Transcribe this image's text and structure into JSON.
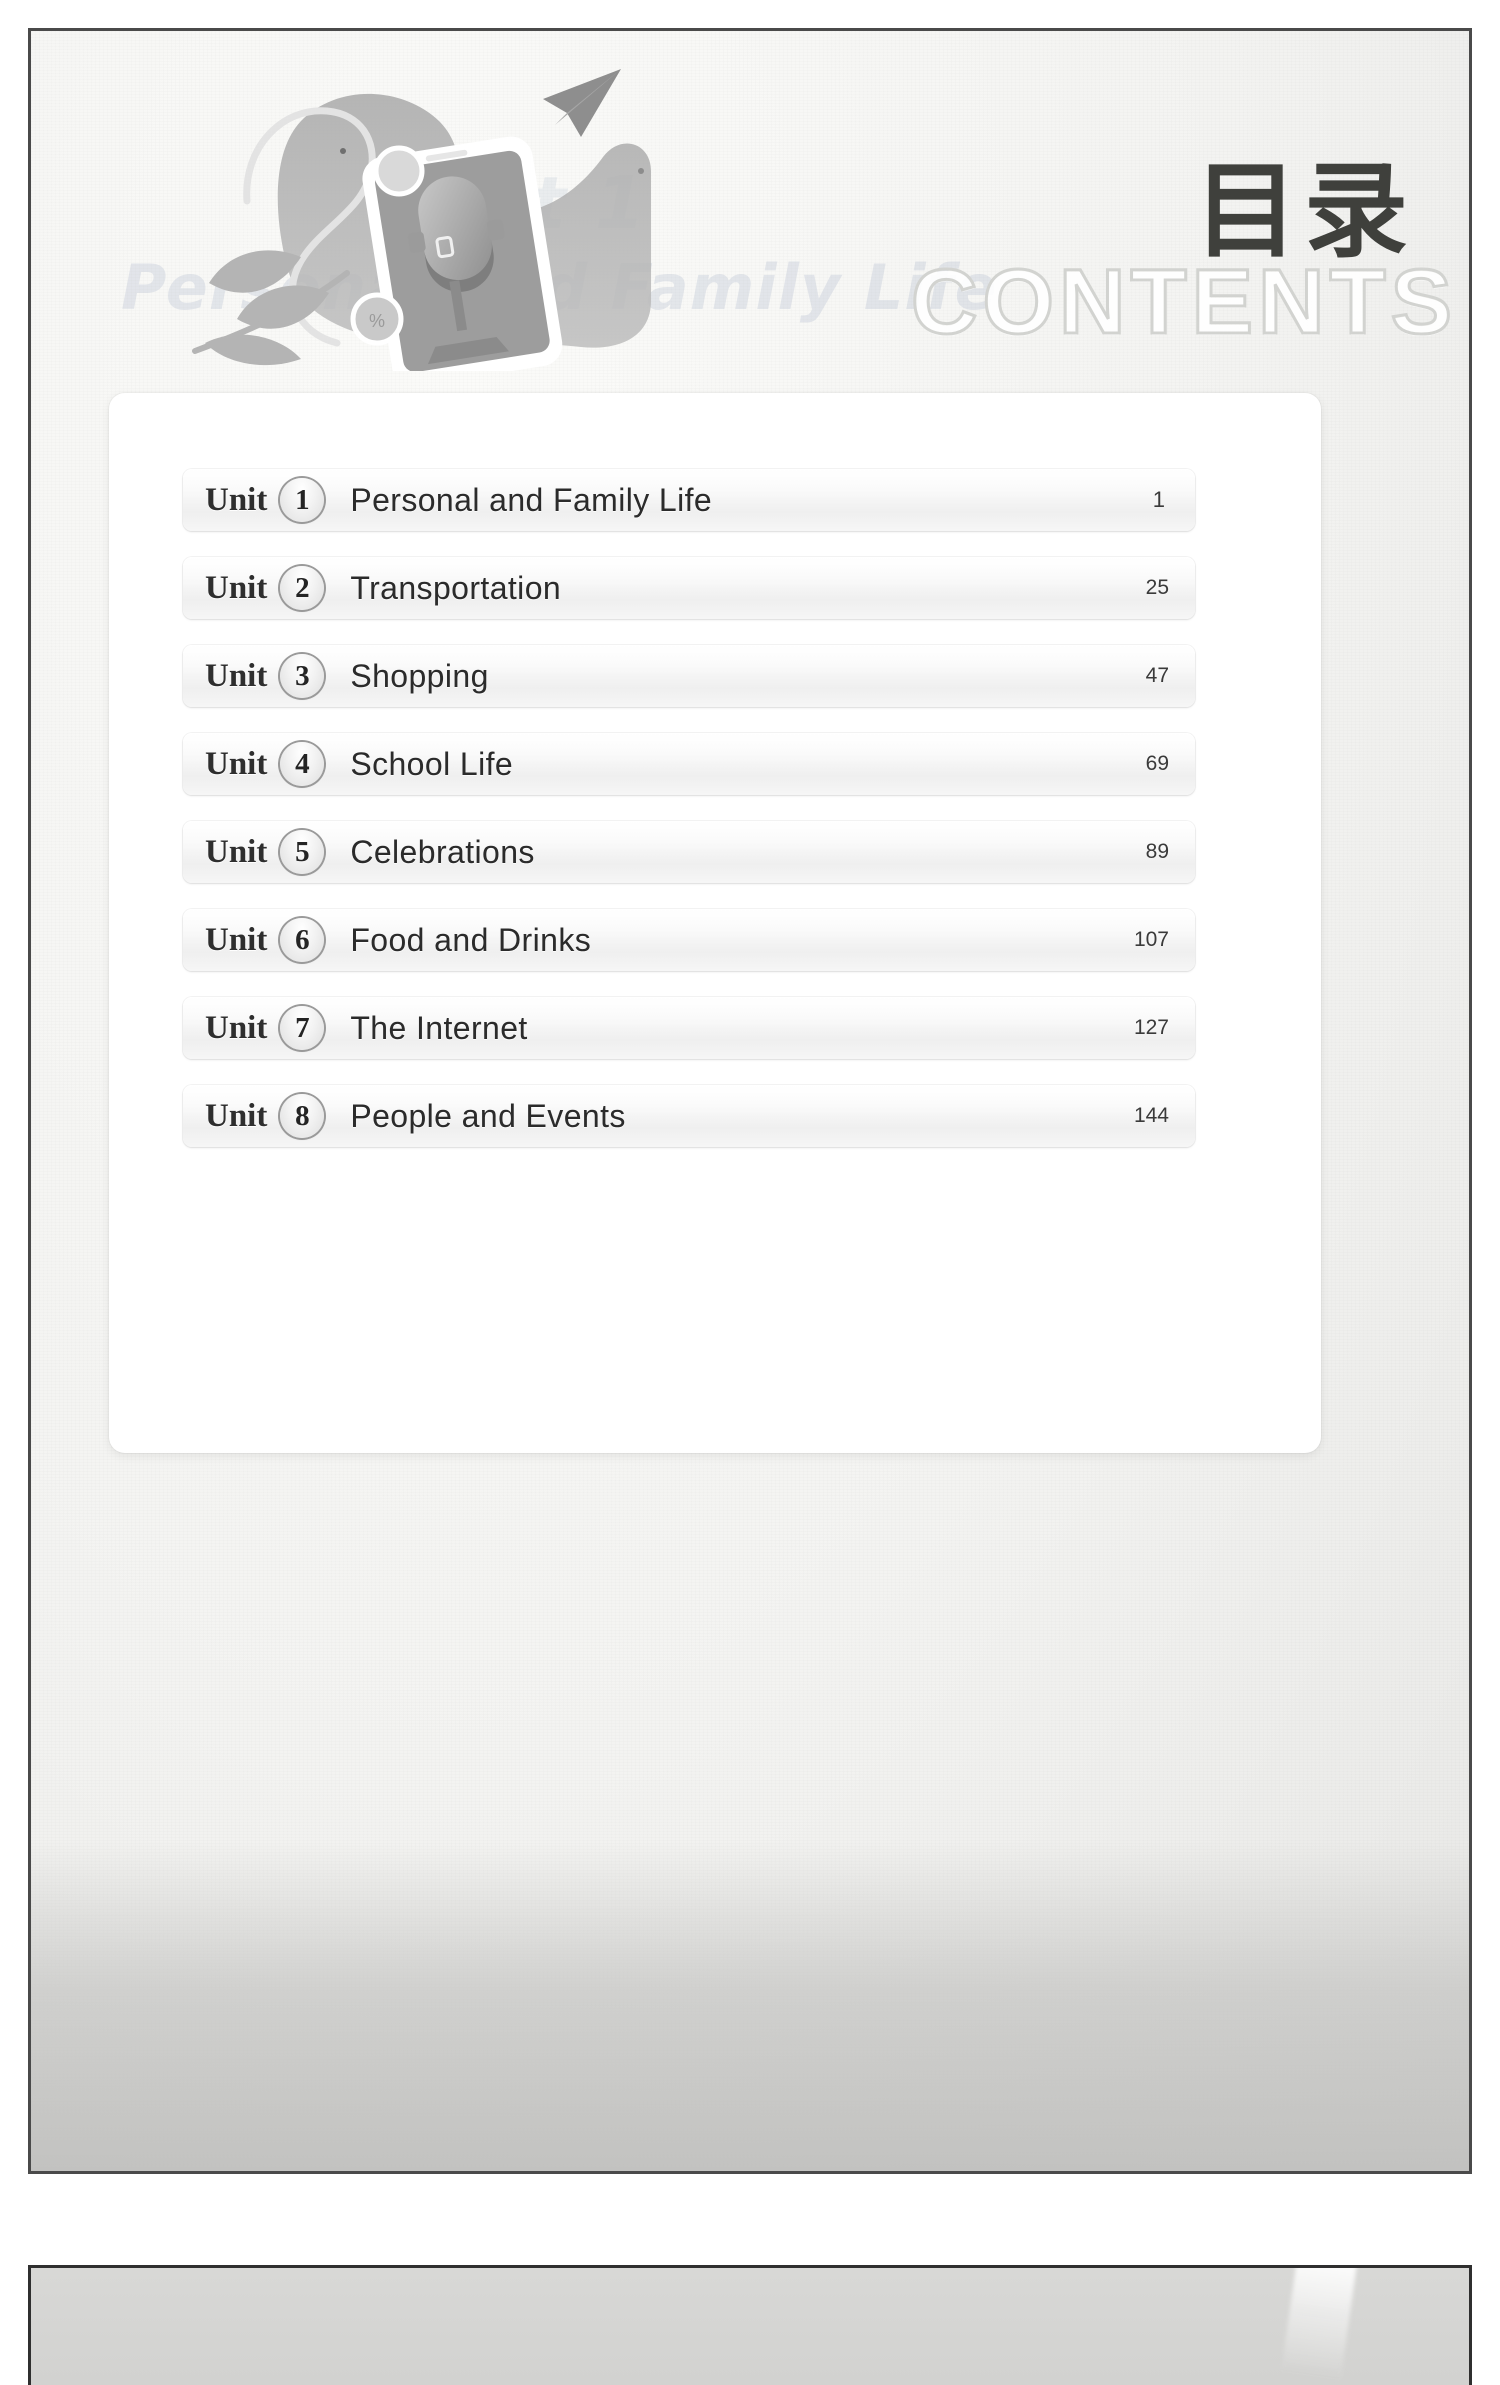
{
  "page": {
    "title_cn": "目录",
    "title_en": "CONTENTS",
    "watermark": {
      "unit_label": "Unit 1",
      "unit_title": "Personal and Family Life"
    },
    "illustration": {
      "name": "podcast-microphone-smartphone-illustration",
      "elements": [
        "smartphone",
        "microphone",
        "paper-plane",
        "leaves",
        "blob-shape",
        "coin-badge"
      ]
    }
  },
  "toc": {
    "unit_word": "Unit",
    "rows": [
      {
        "number": "1",
        "title": "Personal and Family Life",
        "page": "1"
      },
      {
        "number": "2",
        "title": "Transportation",
        "page": "25"
      },
      {
        "number": "3",
        "title": "Shopping",
        "page": "47"
      },
      {
        "number": "4",
        "title": "School Life",
        "page": "69"
      },
      {
        "number": "5",
        "title": "Celebrations",
        "page": "89"
      },
      {
        "number": "6",
        "title": "Food and Drinks",
        "page": "107"
      },
      {
        "number": "7",
        "title": "The Internet",
        "page": "127"
      },
      {
        "number": "8",
        "title": "People and Events",
        "page": "144"
      }
    ]
  },
  "colors": {
    "title_dark": "#3f403c",
    "contents_outline": "#d2d3d0",
    "page_border": "#4a4a4a",
    "card_bg": "#ffffff",
    "row_text": "#2b2b2b"
  }
}
